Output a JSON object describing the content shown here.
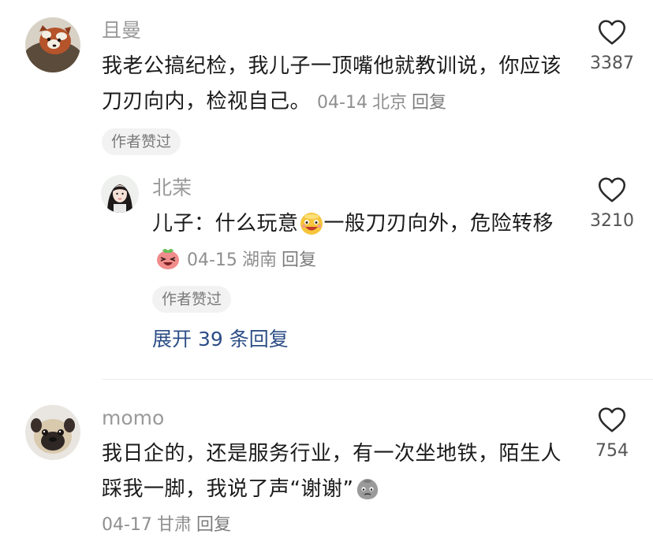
{
  "comments": [
    {
      "username": "且曼",
      "text": "我老公搞纪检，我儿子一顶嘴他就教训说，你应该刀刃向内，检视自己。",
      "date": "04-14",
      "location": "北京",
      "reply_label": "回复",
      "badge": "作者赞过",
      "likes": "3387",
      "avatar_icon": "red-panda-avatar"
    },
    {
      "username": "北茉",
      "text_part1": "儿子：什么玩意",
      "emoji1": "grinning-emoji",
      "text_part2": "一般刀刃向外，危险转移",
      "emoji2": "laughing-emoji",
      "date": "04-15",
      "location": "湖南",
      "reply_label": "回复",
      "badge": "作者赞过",
      "likes": "3210",
      "avatar_icon": "girl-avatar"
    },
    {
      "username": "momo",
      "text": "我日企的，还是服务行业，有一次坐地铁，陌生人踩我一脚，我说了声“谢谢”",
      "emoji": "gray-face-emoji",
      "date": "04-17",
      "location": "甘肃",
      "reply_label": "回复",
      "likes": "754",
      "avatar_icon": "pug-avatar"
    }
  ],
  "expand_replies": "展开 39 条回复",
  "colors": {
    "username": "#9a9a9a",
    "link": "#2d4e87",
    "meta": "#8f8f8f",
    "badge_bg": "#f2f2f2"
  }
}
